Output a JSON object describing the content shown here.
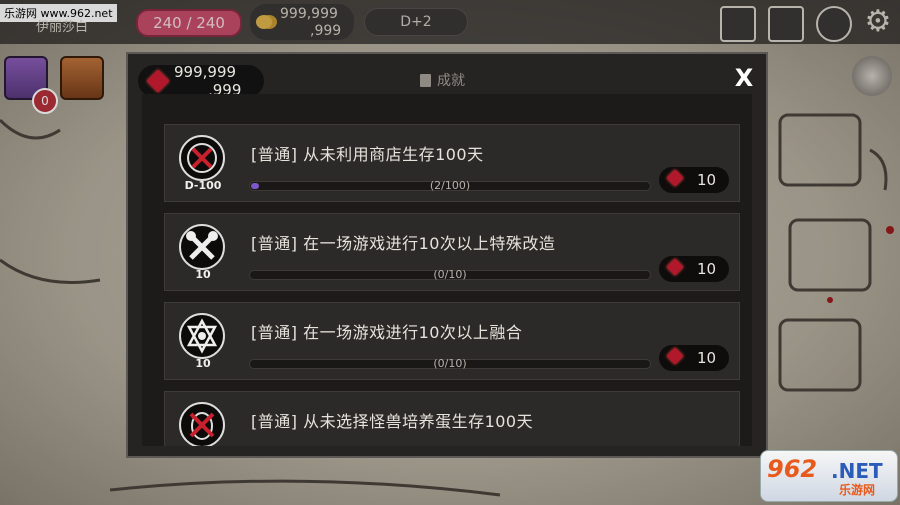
{
  "hud": {
    "site_tag": "乐游网 www.962.net",
    "location": "伊丽莎白",
    "hp": "240 / 240",
    "gold_line1": "999,999",
    "gold_line2": ",999",
    "day": "D+2"
  },
  "side": {
    "badge_count": "0"
  },
  "panel": {
    "title": "成就",
    "close_label": "X",
    "gems_line1": "999,999",
    "gems_line2": ",999",
    "achievements": [
      {
        "title": "[普通] 从未利用商店生存100天",
        "sub": "D-100",
        "progress_text": "(2/100)",
        "progress": 0.02,
        "reward": "10",
        "icon": "no-shop-icon"
      },
      {
        "title": "[普通] 在一场游戏进行10次以上特殊改造",
        "sub": "10",
        "progress_text": "(0/10)",
        "progress": 0.0,
        "reward": "10",
        "icon": "tools-icon"
      },
      {
        "title": "[普通] 在一场游戏进行10次以上融合",
        "sub": "10",
        "progress_text": "(0/10)",
        "progress": 0.0,
        "reward": "10",
        "icon": "fusion-icon"
      },
      {
        "title": "[普通] 从未选择怪兽培养蛋生存100天",
        "sub": "",
        "progress_text": "",
        "progress": 0.0,
        "reward": "",
        "icon": "no-egg-icon"
      }
    ]
  },
  "watermark": {
    "big": "962",
    "net": ".NET",
    "cn": "乐游网"
  },
  "colors": {
    "hp": "#c84e6b",
    "progress": "#7b58c9",
    "gem": "#b2182b"
  }
}
